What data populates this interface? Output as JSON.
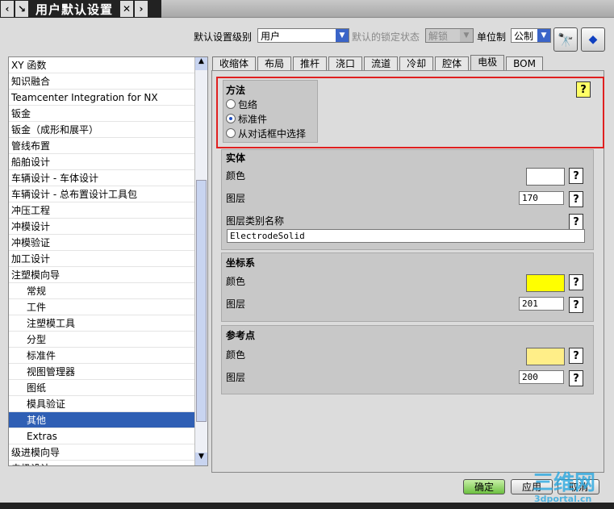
{
  "window": {
    "title": "用户默认设置"
  },
  "toolbar": {
    "level_label": "默认设置级别",
    "level_value": "用户",
    "lock_label": "默认的锁定状态",
    "lock_value": "解锁",
    "unit_label": "单位制",
    "unit_value": "公制"
  },
  "sidebar": {
    "items": [
      {
        "label": "XY 函数"
      },
      {
        "label": "知识融合"
      },
      {
        "label": "Teamcenter Integration for NX"
      },
      {
        "label": "钣金"
      },
      {
        "label": "钣金（成形和展平）"
      },
      {
        "label": "管线布置"
      },
      {
        "label": "船舶设计"
      },
      {
        "label": "车辆设计 - 车体设计"
      },
      {
        "label": "车辆设计 - 总布置设计工具包"
      },
      {
        "label": "冲压工程"
      },
      {
        "label": "冲模设计"
      },
      {
        "label": "冲模验证"
      },
      {
        "label": "加工设计"
      },
      {
        "label": "注塑模向导"
      },
      {
        "label": "常规",
        "sub": true
      },
      {
        "label": "工件",
        "sub": true
      },
      {
        "label": "注塑模工具",
        "sub": true
      },
      {
        "label": "分型",
        "sub": true
      },
      {
        "label": "标准件",
        "sub": true
      },
      {
        "label": "视图管理器",
        "sub": true
      },
      {
        "label": "图纸",
        "sub": true
      },
      {
        "label": "模具验证",
        "sub": true
      },
      {
        "label": "其他",
        "sub": true,
        "selected": true
      },
      {
        "label": "Extras",
        "sub": true
      },
      {
        "label": "级进模向导"
      },
      {
        "label": "电极设计"
      }
    ]
  },
  "tabs": [
    {
      "label": "收缩体"
    },
    {
      "label": "布局"
    },
    {
      "label": "推杆"
    },
    {
      "label": "浇口"
    },
    {
      "label": "流道"
    },
    {
      "label": "冷却"
    },
    {
      "label": "腔体"
    },
    {
      "label": "电极",
      "active": true
    },
    {
      "label": "BOM"
    }
  ],
  "method": {
    "title": "方法",
    "options": [
      {
        "label": "包络",
        "checked": false
      },
      {
        "label": "标准件",
        "checked": true
      },
      {
        "label": "从对话框中选择",
        "checked": false
      }
    ]
  },
  "solid": {
    "title": "实体",
    "color_label": "颜色",
    "color": "#ffffff",
    "layer_label": "图层",
    "layer": "170",
    "category_label": "图层类别名称",
    "category": "ElectrodeSolid"
  },
  "csys": {
    "title": "坐标系",
    "color_label": "颜色",
    "color": "#ffff00",
    "layer_label": "图层",
    "layer": "201"
  },
  "refpoint": {
    "title": "参考点",
    "color_label": "颜色",
    "color": "#ffee88",
    "layer_label": "图层",
    "layer": "200"
  },
  "buttons": {
    "ok": "确定",
    "apply": "应用",
    "cancel": "取消"
  },
  "watermark": {
    "text": "三维网",
    "sub": "3dportal.cn"
  },
  "colors": {
    "highlight": "#e02020",
    "selected": "#2f5fb4"
  }
}
